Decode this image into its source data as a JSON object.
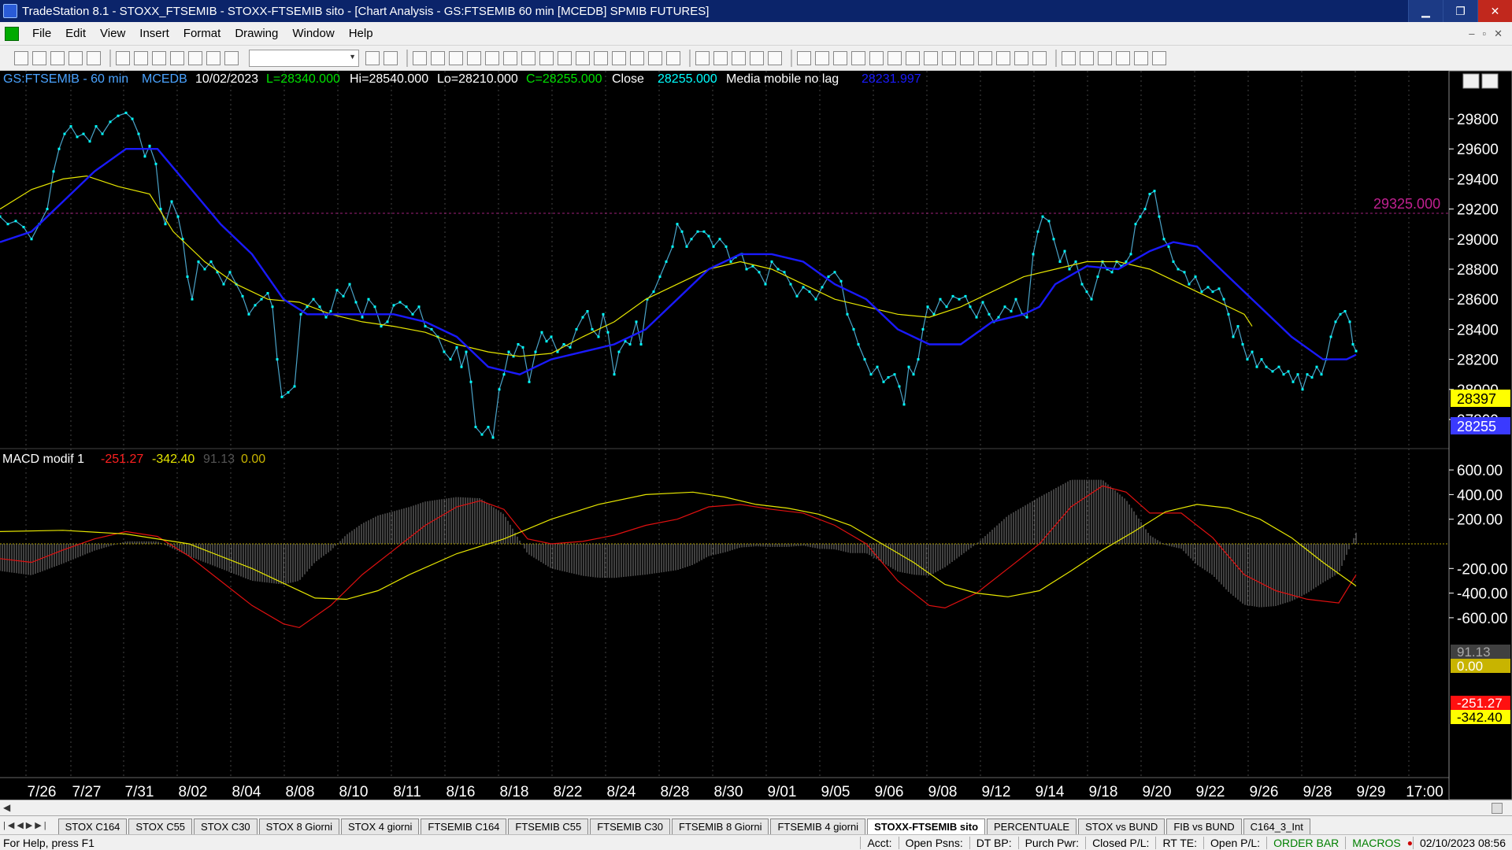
{
  "window": {
    "title": "TradeStation 8.1 - STOXX_FTSEMIB - STOXX-FTSEMIB sito - [Chart Analysis - GS:FTSEMIB  60 min  [MCEDB] SPMIB FUTURES]",
    "minimize": "▁",
    "restore": "❐",
    "close": "✕"
  },
  "menu": {
    "items": [
      "File",
      "Edit",
      "View",
      "Insert",
      "Format",
      "Drawing",
      "Window",
      "Help"
    ],
    "mdi_controls": [
      "–",
      "▫",
      "✕"
    ]
  },
  "chart": {
    "symbol_info": "GS:FTSEMIB - 60 min",
    "exchange": "MCEDB",
    "date": "10/02/2023",
    "last": "L=28340.000",
    "high": "Hi=28540.000",
    "low": "Lo=28210.000",
    "close_eq": "C=28255.000",
    "close_label": "Close",
    "close_value": "28255.000",
    "ma_label": "Media mobile no lag",
    "ma_value": "28231.997",
    "hline_label": "29325.000",
    "price_badge_yellow": "28397",
    "price_badge_blue": "28255",
    "price_ticks": [
      "29800",
      "29600",
      "29400",
      "29200",
      "29000",
      "28800",
      "28600",
      "28400",
      "28200",
      "28000",
      "27800"
    ],
    "x_labels": [
      "7/26",
      "7/27",
      "7/31",
      "8/02",
      "8/04",
      "8/08",
      "8/10",
      "8/11",
      "8/16",
      "8/18",
      "8/22",
      "8/24",
      "8/28",
      "8/30",
      "9/01",
      "9/05",
      "9/06",
      "9/08",
      "9/12",
      "9/14",
      "9/18",
      "9/20",
      "9/22",
      "9/26",
      "9/28",
      "9/29",
      "17:00"
    ],
    "colors": {
      "price": "#4aa3c8",
      "marker": "#00ffff",
      "blue_ma": "#1a1aff",
      "yellow_ma": "#e6e600",
      "macd_red": "#e01010",
      "macd_yellow": "#e6e600",
      "hist": "#808080",
      "hline": "#a0207a"
    }
  },
  "macd": {
    "label": "MACD modif 1",
    "v1": "-251.27",
    "v2": "-342.40",
    "v3": "91.13",
    "v4": "0.00",
    "ticks": [
      "600.00",
      "400.00",
      "200.00",
      "-200.00",
      "-400.00",
      "-600.00"
    ],
    "badge_hist": "91.13",
    "badge_zero": "0.00",
    "badge_red": "-251.27",
    "badge_yellow": "-342.40"
  },
  "tabs": [
    {
      "label": "STOX C164",
      "active": false
    },
    {
      "label": "STOX C55",
      "active": false
    },
    {
      "label": "STOX  C30",
      "active": false
    },
    {
      "label": "STOX  8 Giorni",
      "active": false
    },
    {
      "label": "STOX 4 giorni",
      "active": false
    },
    {
      "label": "FTSEMIB C164",
      "active": false
    },
    {
      "label": "FTSEMIB C55",
      "active": false
    },
    {
      "label": "FTSEMIB C30",
      "active": false
    },
    {
      "label": "FTSEMIB  8 Giorni",
      "active": false
    },
    {
      "label": "FTSEMIB  4 giorni",
      "active": false
    },
    {
      "label": "STOXX-FTSEMIB sito",
      "active": true
    },
    {
      "label": "PERCENTUALE",
      "active": false
    },
    {
      "label": "STOX vs BUND",
      "active": false
    },
    {
      "label": "FIB vs BUND",
      "active": false
    },
    {
      "label": "C164_3_Int",
      "active": false
    }
  ],
  "status": {
    "help": "For Help, press F1",
    "acct": "Acct:",
    "open_psns": "Open Psns:",
    "dt_bp": "DT BP:",
    "purch_pwr": "Purch Pwr:",
    "closed_pl": "Closed P/L:",
    "rt_te": "RT TE:",
    "open_pl": "Open P/L:",
    "order_bar": "ORDER BAR",
    "macros": "MACROS",
    "datetime": "02/10/2023 08:56"
  }
}
